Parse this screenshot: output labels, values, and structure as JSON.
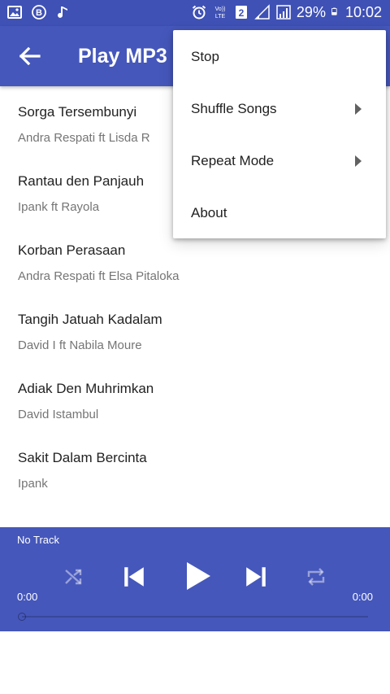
{
  "status_bar": {
    "battery_percent": "29%",
    "time": "10:02",
    "volte_label": "Vo)) LTE",
    "sim_badge": "2",
    "left_icons": [
      "gallery-icon",
      "bbm-icon",
      "music-note-icon"
    ],
    "right_icons": [
      "alarm-icon",
      "volte-icon",
      "sim-2-icon",
      "signal-icon",
      "signal-2-icon",
      "battery-icon"
    ]
  },
  "app_bar": {
    "back_icon": "arrow-back-icon",
    "title": "Play MP3"
  },
  "songs": [
    {
      "title": "Sorga Tersembunyi",
      "artist": "Andra Respati ft Lisda R"
    },
    {
      "title": "Rantau den Panjauh",
      "artist": "Ipank ft Rayola"
    },
    {
      "title": "Korban Perasaan",
      "artist": "Andra Respati ft Elsa Pitaloka"
    },
    {
      "title": "Tangih Jatuah Kadalam",
      "artist": "David I ft Nabila Moure"
    },
    {
      "title": "Adiak Den Muhrimkan",
      "artist": "David Istambul"
    },
    {
      "title": "Sakit Dalam Bercinta",
      "artist": "Ipank"
    }
  ],
  "menu": {
    "items": [
      {
        "label": "Stop",
        "has_submenu": false
      },
      {
        "label": "Shuffle Songs",
        "has_submenu": true
      },
      {
        "label": "Repeat Mode",
        "has_submenu": true
      },
      {
        "label": "About",
        "has_submenu": false
      }
    ]
  },
  "player": {
    "track_label": "No Track",
    "elapsed": "0:00",
    "duration": "0:00",
    "progress": 0,
    "controls": [
      "shuffle-icon",
      "previous-icon",
      "play-icon",
      "next-icon",
      "repeat-icon"
    ]
  },
  "colors": {
    "primary": "#4557bb",
    "status_bar": "#3f51b5",
    "menu_bg": "#ffffff"
  }
}
